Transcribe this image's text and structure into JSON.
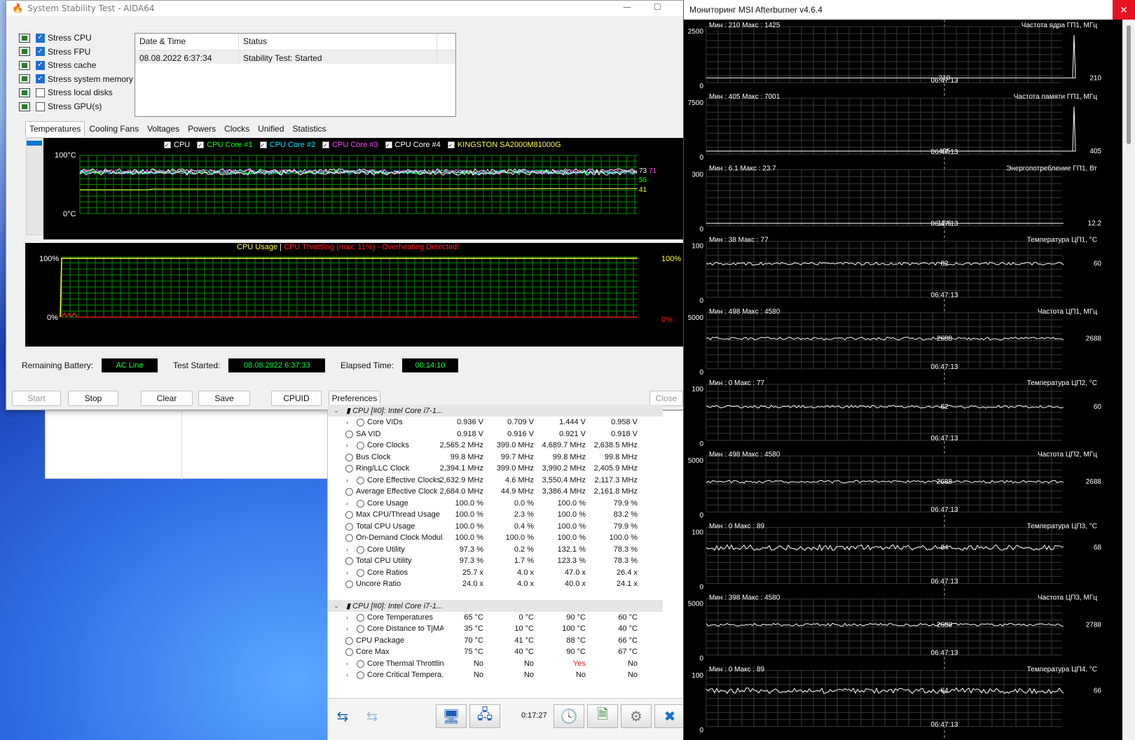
{
  "aida": {
    "title": "System Stability Test - AIDA64",
    "stress": [
      {
        "label": "Stress CPU",
        "checked": true
      },
      {
        "label": "Stress FPU",
        "checked": true
      },
      {
        "label": "Stress cache",
        "checked": true
      },
      {
        "label": "Stress system memory",
        "checked": true
      },
      {
        "label": "Stress local disks",
        "checked": false
      },
      {
        "label": "Stress GPU(s)",
        "checked": false
      }
    ],
    "log": {
      "col1": "Date & Time",
      "col2": "Status",
      "rows": [
        {
          "time": "08.08.2022 6:37:34",
          "status": "Stability Test: Started"
        }
      ]
    },
    "tabs": [
      "Temperatures",
      "Cooling Fans",
      "Voltages",
      "Powers",
      "Clocks",
      "Unified",
      "Statistics"
    ],
    "temp_legend": [
      {
        "label": "CPU",
        "color": "#ffffff"
      },
      {
        "label": "CPU Core #1",
        "color": "#00ff00"
      },
      {
        "label": "CPU Core #2",
        "color": "#00e5ff"
      },
      {
        "label": "CPU Core #3",
        "color": "#ff40ff"
      },
      {
        "label": "CPU Core #4",
        "color": "#ffffff"
      },
      {
        "label": "KINGSTON SA2000M81000G",
        "color": "#ffff40"
      }
    ],
    "temp_axis": {
      "top": "100°C",
      "bottom": "0°C"
    },
    "temp_values": [
      "73",
      "71",
      "56",
      "41"
    ],
    "usage_title": {
      "usage": "CPU Usage",
      "sep": "|",
      "throttle": "CPU Throttling (max: 11%) - Overheating Detected!"
    },
    "usage_axis": {
      "top": "100%",
      "bottom": "0%",
      "right_top": "100%",
      "right_bottom": "0%"
    },
    "status": {
      "battery_label": "Remaining Battery:",
      "battery": "AC Line",
      "started_label": "Test Started:",
      "started": "08.08.2022 6:37:33",
      "elapsed_label": "Elapsed Time:",
      "elapsed": "00:14:10"
    },
    "buttons": {
      "start": "Start",
      "stop": "Stop",
      "clear": "Clear",
      "save": "Save",
      "cpuid": "CPUID",
      "prefs": "Preferences",
      "close": "Close"
    }
  },
  "sensors": {
    "groups": [
      {
        "title": "CPU [#0]: Intel Core i7-1...",
        "rows": [
          {
            "name": "Core VIDs",
            "exp": true,
            "vals": [
              "0.936 V",
              "0.709 V",
              "1.444 V",
              "0.958 V"
            ]
          },
          {
            "name": "SA VID",
            "exp": false,
            "vals": [
              "0.918 V",
              "0.916 V",
              "0.921 V",
              "0.918 V"
            ]
          },
          {
            "name": "Core Clocks",
            "exp": true,
            "vals": [
              "2,565.2 MHz",
              "399.0 MHz",
              "4,689.7 MHz",
              "2,638.5 MHz"
            ]
          },
          {
            "name": "Bus Clock",
            "exp": false,
            "vals": [
              "99.8 MHz",
              "99.7 MHz",
              "99.8 MHz",
              "99.8 MHz"
            ]
          },
          {
            "name": "Ring/LLC Clock",
            "exp": false,
            "vals": [
              "2,394.1 MHz",
              "399.0 MHz",
              "3,990.2 MHz",
              "2,405.9 MHz"
            ]
          },
          {
            "name": "Core Effective Clocks",
            "exp": true,
            "vals": [
              "2,632.9 MHz",
              "4.6 MHz",
              "3,550.4 MHz",
              "2,117.3 MHz"
            ]
          },
          {
            "name": "Average Effective Clock",
            "exp": false,
            "vals": [
              "2,684.0 MHz",
              "44.9 MHz",
              "3,386.4 MHz",
              "2,161.8 MHz"
            ]
          },
          {
            "name": "Core Usage",
            "exp": true,
            "vals": [
              "100.0 %",
              "0.0 %",
              "100.0 %",
              "79.9 %"
            ]
          },
          {
            "name": "Max CPU/Thread Usage",
            "exp": false,
            "vals": [
              "100.0 %",
              "2.3 %",
              "100.0 %",
              "83.2 %"
            ]
          },
          {
            "name": "Total CPU Usage",
            "exp": false,
            "vals": [
              "100.0 %",
              "0.4 %",
              "100.0 %",
              "79.9 %"
            ]
          },
          {
            "name": "On-Demand Clock Modul...",
            "exp": false,
            "vals": [
              "100.0 %",
              "100.0 %",
              "100.0 %",
              "100.0 %"
            ]
          },
          {
            "name": "Core Utility",
            "exp": true,
            "vals": [
              "97.3 %",
              "0.2 %",
              "132.1 %",
              "78.3 %"
            ]
          },
          {
            "name": "Total CPU Utility",
            "exp": false,
            "vals": [
              "97.3 %",
              "1.7 %",
              "123.3 %",
              "78.3 %"
            ]
          },
          {
            "name": "Core Ratios",
            "exp": true,
            "vals": [
              "25.7 x",
              "4.0 x",
              "47.0 x",
              "26.4 x"
            ]
          },
          {
            "name": "Uncore Ratio",
            "exp": false,
            "vals": [
              "24.0 x",
              "4.0 x",
              "40.0 x",
              "24.1 x"
            ]
          }
        ]
      },
      {
        "title": "CPU [#0]: Intel Core i7-1...",
        "rows": [
          {
            "name": "Core Temperatures",
            "exp": true,
            "vals": [
              "65 °C",
              "0 °C",
              "90 °C",
              "60 °C"
            ]
          },
          {
            "name": "Core Distance to TjMAX",
            "exp": true,
            "vals": [
              "35 °C",
              "10 °C",
              "100 °C",
              "40 °C"
            ]
          },
          {
            "name": "CPU Package",
            "exp": false,
            "vals": [
              "70 °C",
              "41 °C",
              "88 °C",
              "66 °C"
            ]
          },
          {
            "name": "Core Max",
            "exp": false,
            "vals": [
              "75 °C",
              "40 °C",
              "90 °C",
              "67 °C"
            ]
          },
          {
            "name": "Core Thermal Throttling",
            "exp": true,
            "vals": [
              "No",
              "No",
              "Yes",
              "No"
            ]
          },
          {
            "name": "Core Critical Tempera...",
            "exp": true,
            "vals": [
              "No",
              "No",
              "No",
              "No"
            ]
          }
        ]
      }
    ],
    "clock": "0:17:27"
  },
  "msi": {
    "title": "Мониторинг MSI Afterburner v4.6.4",
    "graphs": [
      {
        "ymax": "2500",
        "ymin": "0",
        "minmax": "Мин : 210   Макс : 1425",
        "name": "Частота ядра ГП1, МГц",
        "center": "210",
        "right": "210",
        "time": "06:47:13",
        "spike": true,
        "level": 0.084,
        "noise": 0
      },
      {
        "ymax": "7500",
        "ymin": "0",
        "minmax": "Мин : 405   Макс : 7001",
        "name": "Частота памяти ГП1, МГц",
        "center": "405",
        "right": "405",
        "time": "06:47:13",
        "spike": true,
        "level": 0.054,
        "noise": 0
      },
      {
        "ymax": "300",
        "ymin": "0",
        "minmax": "Мин : 6.1   Макс : 23.7",
        "name": "Энергопотребление ГП1, Вт",
        "center": "12.6",
        "right": "12.2",
        "time": "06:47:13",
        "spike": false,
        "level": 0.042,
        "noise": 0
      },
      {
        "ymax": "100",
        "ymin": "0",
        "minmax": "Мин : 38   Макс : 77",
        "name": "Температура ЦП1, °С",
        "center": "62",
        "right": "60",
        "time": "06:47:13",
        "spike": false,
        "level": 0.6,
        "noise": 2
      },
      {
        "ymax": "5000",
        "ymin": "0",
        "minmax": "Мин : 498   Макс : 4580",
        "name": "Частота ЦП1, МГц",
        "center": "2688",
        "right": "2688",
        "time": "06:47:13",
        "spike": false,
        "level": 0.54,
        "noise": 2
      },
      {
        "ymax": "100",
        "ymin": "0",
        "minmax": "Мин : 0   Макс : 77",
        "name": "Температура ЦП2, °С",
        "center": "62",
        "right": "60",
        "time": "06:47:13",
        "spike": false,
        "level": 0.6,
        "noise": 2
      },
      {
        "ymax": "5000",
        "ymin": "0",
        "minmax": "Мин : 498   Макс : 4580",
        "name": "Частота ЦП2, МГц",
        "center": "2688",
        "right": "2688",
        "time": "06:47:13",
        "spike": false,
        "level": 0.54,
        "noise": 2
      },
      {
        "ymax": "100",
        "ymin": "0",
        "minmax": "Мин : 0   Макс : 89",
        "name": "Температура ЦП3, °С",
        "center": "64",
        "right": "68",
        "time": "06:47:13",
        "spike": false,
        "level": 0.64,
        "noise": 4
      },
      {
        "ymax": "5000",
        "ymin": "0",
        "minmax": "Мин : 398   Макс : 4580",
        "name": "Частота ЦП3, МГц",
        "center": "2688",
        "right": "2788",
        "time": "06:47:13",
        "spike": false,
        "level": 0.54,
        "noise": 2
      },
      {
        "ymax": "100",
        "ymin": "0",
        "minmax": "Мин : 0   Макс : 89",
        "name": "Температура ЦП4, °С",
        "center": "64",
        "right": "66",
        "time": "06:47:13",
        "spike": false,
        "level": 0.64,
        "noise": 4
      }
    ]
  }
}
